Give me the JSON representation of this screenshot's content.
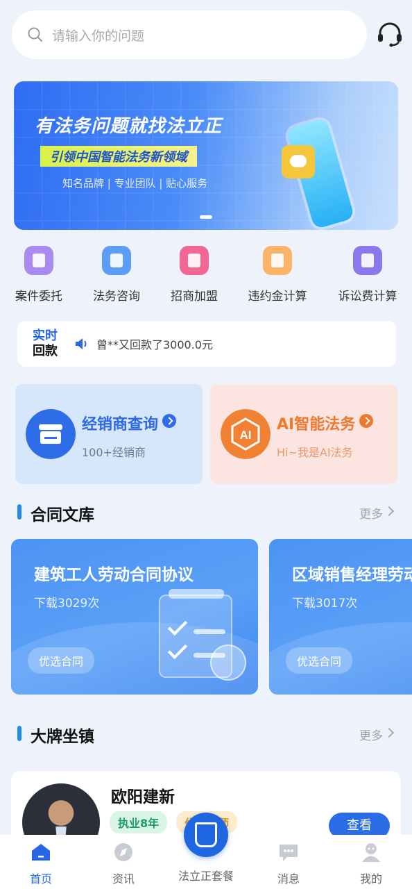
{
  "search": {
    "placeholder": "请输入你的问题"
  },
  "banner": {
    "headline": "有法务问题就找法立正",
    "tagline": "引领中国智能法务新领域",
    "sub": "知名品牌 | 专业团队 | 贴心服务"
  },
  "quick_nav": [
    {
      "label": "案件委托",
      "icon": "case-icon",
      "color": "#a88bf0"
    },
    {
      "label": "法务咨询",
      "icon": "consult-icon",
      "color": "#5c9ef7"
    },
    {
      "label": "招商加盟",
      "icon": "franchise-icon",
      "color": "#f26694"
    },
    {
      "label": "违约金计算",
      "icon": "penalty-calc-icon",
      "color": "#fbb367"
    },
    {
      "label": "诉讼费计算",
      "icon": "litigation-fee-icon",
      "color": "#8a78ec"
    }
  ],
  "ticker": {
    "tag_line1": "实时",
    "tag_line2": "回款",
    "message": "曾**又回款了3000.0元"
  },
  "features": {
    "dealer": {
      "title": "经销商查询",
      "subtitle": "100+经销商"
    },
    "ai": {
      "title": "AI智能法务",
      "subtitle": "Hi~我是AI法务",
      "icon_text": "AI"
    }
  },
  "contracts_section": {
    "title": "合同文库",
    "more": "更多"
  },
  "contracts": [
    {
      "title": "建筑工人劳动合同协议",
      "downloads": "下载3029次",
      "tag": "优选合同"
    },
    {
      "title": "区域销售经理劳动合同",
      "downloads": "下载3017次",
      "tag": "优选合同"
    }
  ],
  "lawyers_section": {
    "title": "大牌坐镇",
    "more": "更多"
  },
  "lawyer": {
    "name": "欧阳建新",
    "badge_years": "执业8年",
    "badge_title": "优选律师",
    "view": "查看"
  },
  "tabbar": {
    "home": "首页",
    "news": "资讯",
    "center": "法立正套餐",
    "messages": "消息",
    "mine": "我的"
  },
  "colors": {
    "primary": "#2766e8",
    "accent_orange": "#ec7a2f",
    "background": "#eef3fb"
  }
}
